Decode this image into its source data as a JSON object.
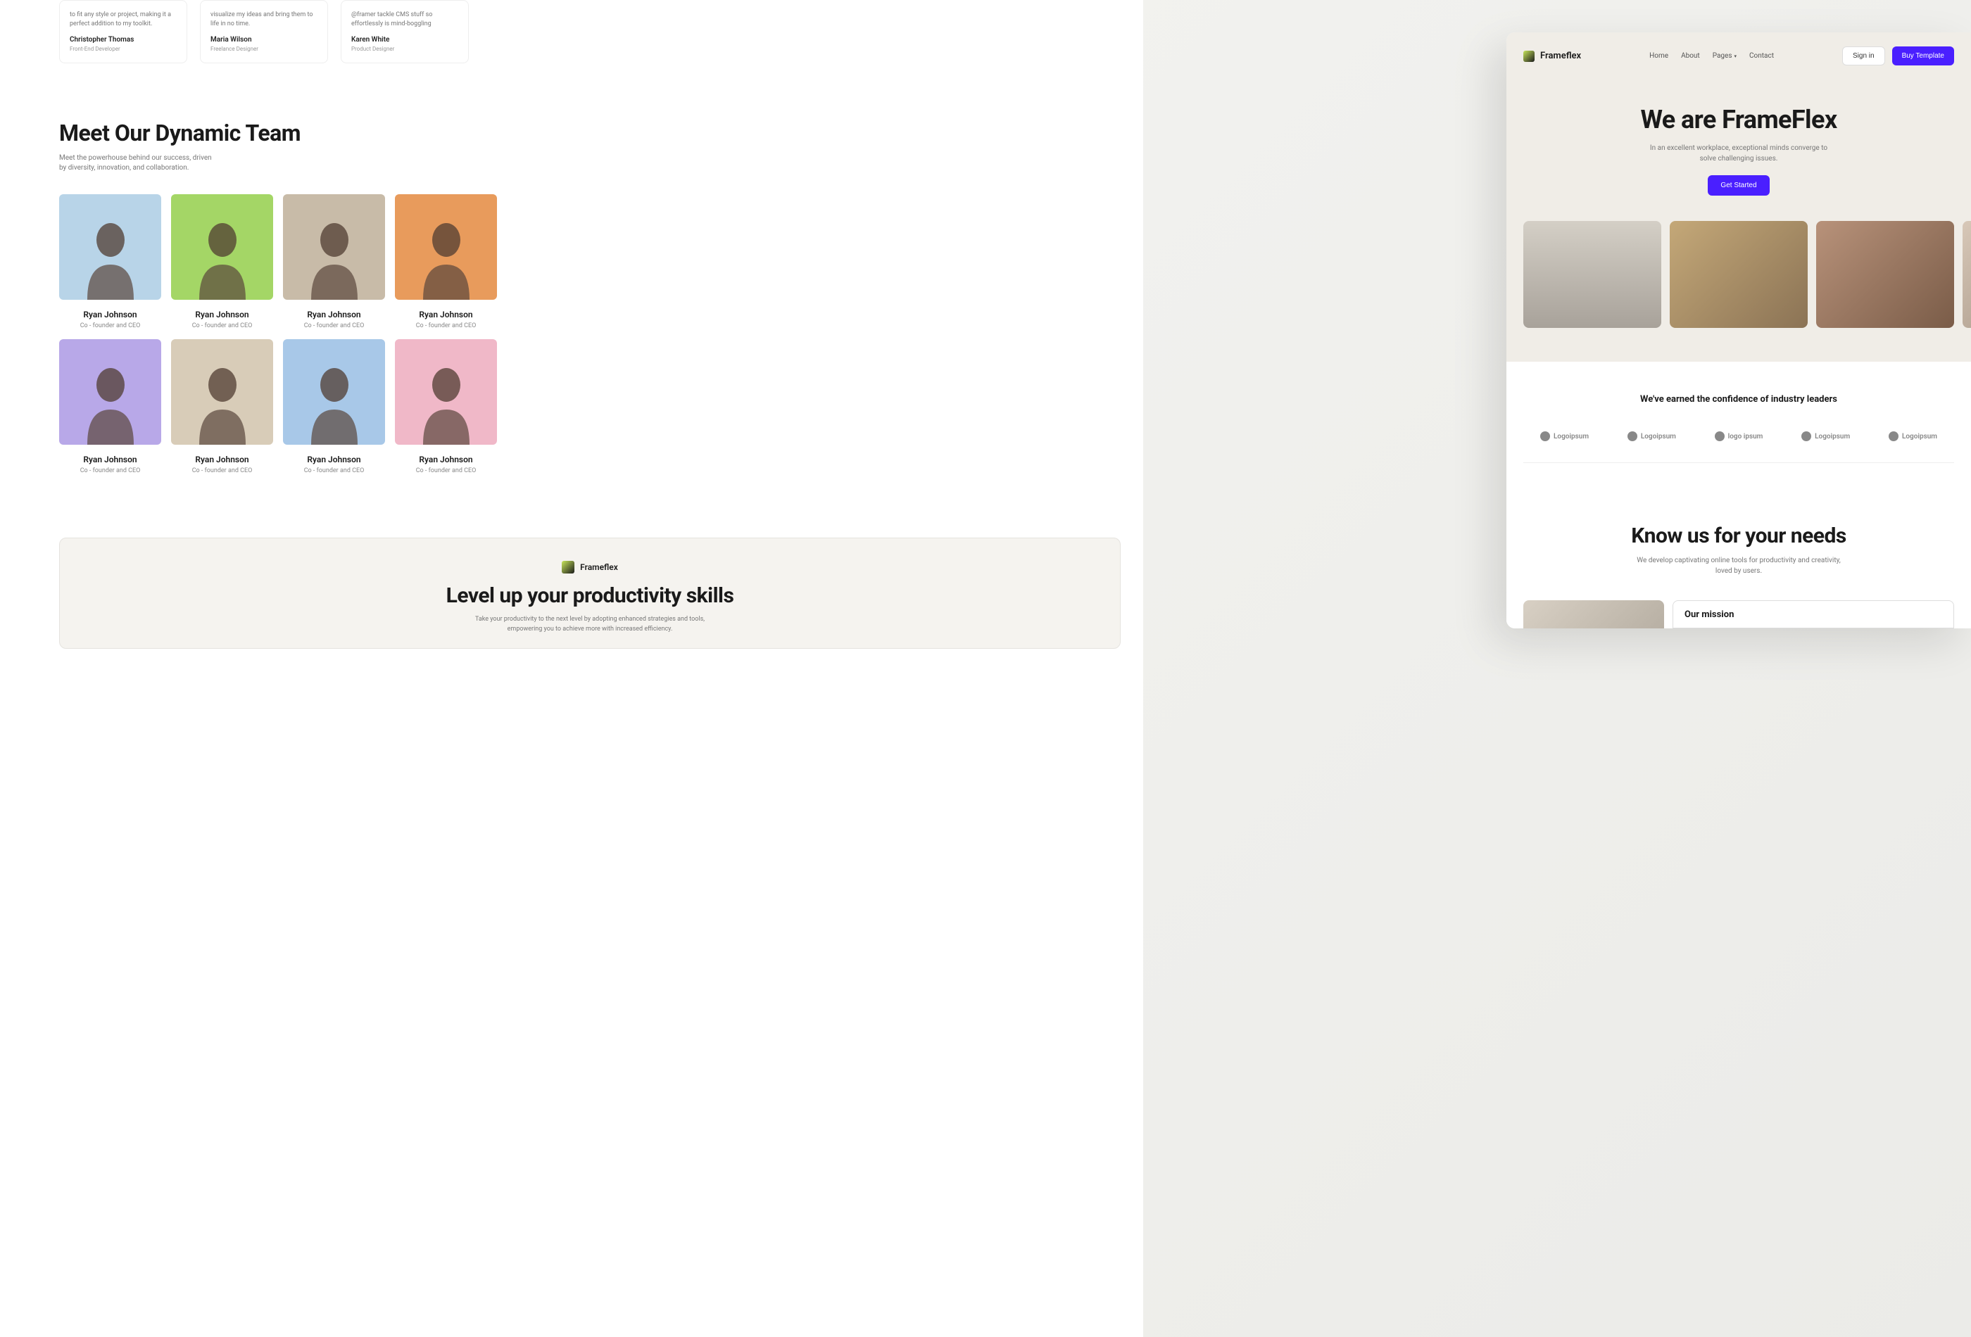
{
  "brand_name": "Frameflex",
  "testimonials": [
    {
      "quote": "to fit any style or project, making it a perfect addition to my toolkit.",
      "name": "Christopher Thomas",
      "role": "Front-End Developer"
    },
    {
      "quote": "visualize my ideas and bring them to life in no time.",
      "name": "Maria Wilson",
      "role": "Freelance Designer"
    },
    {
      "quote": "@framer tackle CMS stuff so effortlessly is mind-boggling",
      "name": "Karen White",
      "role": "Product Designer"
    }
  ],
  "team": {
    "heading": "Meet Our Dynamic Team",
    "subtitle": "Meet the powerhouse behind our success, driven by diversity, innovation, and collaboration.",
    "members": [
      {
        "name": "Ryan Johnson",
        "role": "Co - founder and CEO",
        "bg": "bg-blue-light"
      },
      {
        "name": "Ryan Johnson",
        "role": "Co - founder and CEO",
        "bg": "bg-green"
      },
      {
        "name": "Ryan Johnson",
        "role": "Co - founder and CEO",
        "bg": "bg-tan"
      },
      {
        "name": "Ryan Johnson",
        "role": "Co - founder and CEO",
        "bg": "bg-orange"
      },
      {
        "name": "Ryan Johnson",
        "role": "Co - founder and CEO",
        "bg": "bg-purple"
      },
      {
        "name": "Ryan Johnson",
        "role": "Co - founder and CEO",
        "bg": "bg-cream"
      },
      {
        "name": "Ryan Johnson",
        "role": "Co - founder and CEO",
        "bg": "bg-blue"
      },
      {
        "name": "Ryan Johnson",
        "role": "Co - founder and CEO",
        "bg": "bg-pink"
      }
    ]
  },
  "footer": {
    "heading": "Level up your productivity skills",
    "subtitle": "Take your productivity to the next level by adopting enhanced strategies and tools, empowering you to achieve more with increased efficiency."
  },
  "front": {
    "nav": {
      "links": [
        "Home",
        "About",
        "Pages",
        "Contact"
      ],
      "signin": "Sign in",
      "buy": "Buy Template"
    },
    "hero": {
      "title": "We are FrameFlex",
      "subtitle": "In an excellent workplace, exceptional minds converge to solve challenging issues.",
      "cta": "Get Started"
    },
    "trust": {
      "heading": "We've earned the confidence of industry leaders",
      "logos": [
        "Logoipsum",
        "Logoipsum",
        "logo ipsum",
        "Logoipsum",
        "Logoipsum"
      ]
    },
    "know": {
      "heading": "Know us for your needs",
      "subtitle": "We develop captivating online tools for productivity and creativity, loved by users."
    },
    "mission": {
      "title": "Our mission"
    }
  },
  "colors": {
    "primary": "#4a1fff",
    "text_dark": "#1a1a1a",
    "text_muted": "#777",
    "bg_beige": "#f0ede7"
  }
}
